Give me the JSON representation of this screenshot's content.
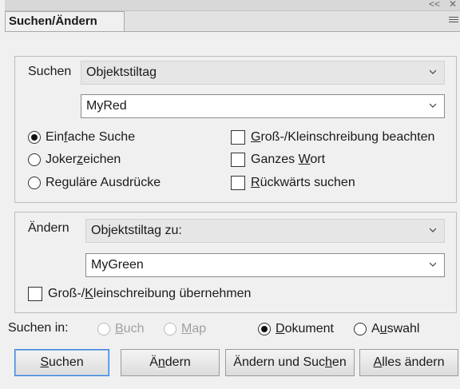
{
  "panel": {
    "collapse_glyph": "<<",
    "close_glyph": "✕",
    "tab_label": "Suchen/Ändern"
  },
  "search": {
    "label": "Suchen",
    "mode_select": "Objektstiltag",
    "value": "MyRed",
    "options": {
      "simple": {
        "pre": "Ein",
        "key": "f",
        "post": "ache Suche",
        "checked": true
      },
      "wildcard": {
        "pre": "Joker",
        "key": "z",
        "post": "eichen",
        "checked": false
      },
      "regex": {
        "pre": "Re",
        "key": "g",
        "post": "uläre Ausdrücke",
        "checked": false
      }
    },
    "checks": {
      "case": {
        "pre": "",
        "key": "G",
        "post": "roß-/Kleinschreibung beachten",
        "checked": false
      },
      "whole_word": {
        "pre": "Ganzes ",
        "key": "W",
        "post": "ort",
        "checked": false
      },
      "backwards": {
        "pre": "",
        "key": "R",
        "post": "ückwärts suchen",
        "checked": false
      }
    }
  },
  "replace": {
    "label": "Ändern",
    "mode_select": "Objektstiltag zu:",
    "value": "MyGreen",
    "preserve_case": {
      "pre": "Groß-/",
      "key": "K",
      "post": "leinschreibung übernehmen",
      "checked": false
    }
  },
  "scope": {
    "label": "Suchen in:",
    "book": {
      "pre": "",
      "key": "B",
      "post": "uch",
      "enabled": false
    },
    "map": {
      "pre": "",
      "key": "M",
      "post": "ap",
      "enabled": false
    },
    "document": {
      "pre": "",
      "key": "D",
      "post": "okument",
      "checked": true
    },
    "selection": {
      "pre": "A",
      "key": "u",
      "post": "swahl",
      "checked": false
    }
  },
  "buttons": {
    "search": {
      "pre": "",
      "key": "S",
      "post": "uchen"
    },
    "replace": {
      "pre": "Ä",
      "key": "n",
      "post": "dern"
    },
    "replace_and_search": {
      "pre": "Ändern und Suc",
      "key": "h",
      "post": "en"
    },
    "replace_all": {
      "pre": "",
      "key": "A",
      "post": "lles ändern"
    }
  }
}
